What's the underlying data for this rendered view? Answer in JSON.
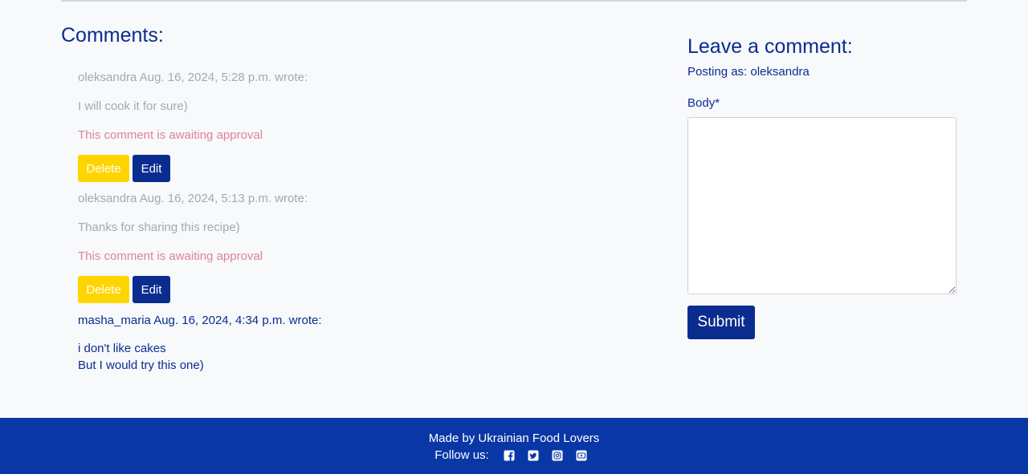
{
  "comments_section": {
    "title": "Comments:",
    "items": [
      {
        "author_line": "oleksandra Aug. 16, 2024, 5:28 p.m. wrote:",
        "body_lines": [
          "I will cook it for sure)"
        ],
        "status": "This comment is awaiting approval",
        "delete_label": "Delete",
        "edit_label": "Edit"
      },
      {
        "author_line": "oleksandra Aug. 16, 2024, 5:13 p.m. wrote:",
        "body_lines": [
          "Thanks for sharing this recipe)"
        ],
        "status": "This comment is awaiting approval",
        "delete_label": "Delete",
        "edit_label": "Edit"
      },
      {
        "author_line": "masha_maria Aug. 16, 2024, 4:34 p.m. wrote:",
        "body_lines": [
          "i don't like cakes",
          "But I would try this one)"
        ]
      }
    ]
  },
  "comment_form": {
    "title": "Leave a comment:",
    "posting_as": "Posting as: oleksandra",
    "body_label": "Body*",
    "body_value": "",
    "submit_label": "Submit"
  },
  "footer": {
    "made_by": "Made by Ukrainian Food Lovers",
    "follow_label": "Follow us:",
    "social_icons": [
      "facebook-icon",
      "twitter-icon",
      "instagram-icon",
      "youtube-icon"
    ]
  },
  "colors": {
    "primary_blue": "#0a2c8f",
    "footer_blue": "#0a37a6",
    "delete_yellow": "#ffd500",
    "pending_text": "#a6a8ab",
    "approval_pink": "#e08299",
    "background": "#f7f9fb"
  }
}
